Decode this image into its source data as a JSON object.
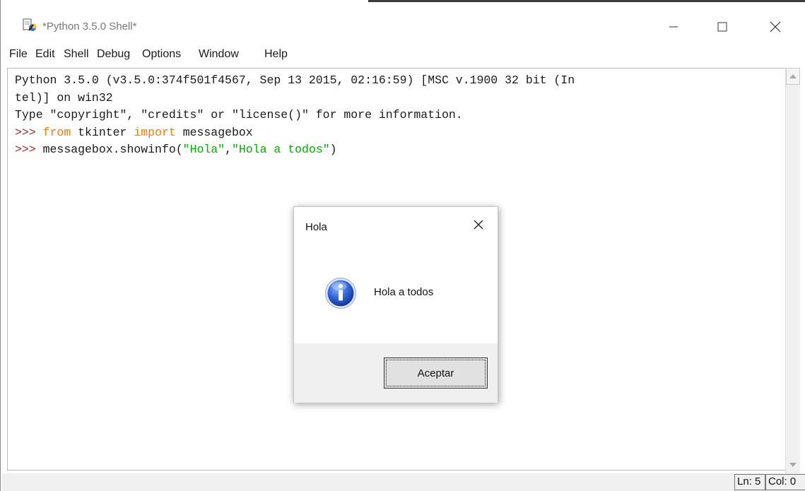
{
  "window": {
    "title": "*Python 3.5.0 Shell*",
    "icon": "idle-app-icon"
  },
  "menu": [
    "File",
    "Edit",
    "Shell",
    "Debug",
    "Options",
    "Window",
    "Help"
  ],
  "shell": {
    "banner_line1": "Python 3.5.0 (v3.5.0:374f501f4567, Sep 13 2015, 02:16:59) [MSC v.1900 32 bit (In",
    "banner_line2": "tel)] on win32",
    "banner_line3": "Type \"copyright\", \"credits\" or \"license()\" for more information.",
    "prompt": ">>>",
    "cmd1": {
      "kw_from": "from",
      "module": "tkinter",
      "kw_import": "import",
      "name": "messagebox"
    },
    "cmd2": {
      "call": "messagebox.showinfo(",
      "arg1": "\"Hola\"",
      "sep": ",",
      "arg2": "\"Hola a todos\"",
      "close": ")"
    }
  },
  "status": {
    "ln": "Ln: 5",
    "col": "Col: 0"
  },
  "dialog": {
    "title": "Hola",
    "message": "Hola a todos",
    "ok_label": "Aceptar",
    "icon": "info-icon"
  },
  "colors": {
    "prompt": "#a52a2a",
    "keyword": "#ff7700",
    "string": "#00aa00"
  }
}
